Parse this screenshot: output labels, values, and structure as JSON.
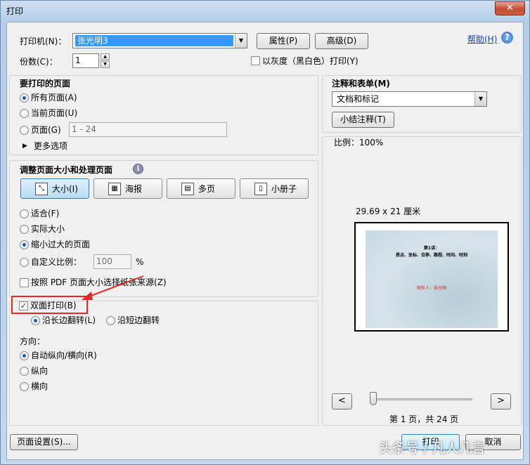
{
  "window": {
    "title": "打印",
    "close_glyph": "✕"
  },
  "header": {
    "printer_label": "打印机(N)：",
    "printer_value": "张光明3",
    "properties_button": "属性(P)",
    "advanced_button": "高级(D)",
    "help_link": "帮助(H)",
    "copies_label": "份数(C)：",
    "copies_value": "1",
    "grayscale_label": "以灰度（黑白色）打印(Y)"
  },
  "pages": {
    "title": "要打印的页面",
    "all_label": "所有页面(A)",
    "current_label": "当前页面(U)",
    "range_label": "页面(G)",
    "range_value": "1 - 24",
    "more_options": "更多选项"
  },
  "sizing": {
    "title": "调整页面大小和处理页面",
    "info_glyph": "i",
    "tabs": [
      {
        "label": "大小(I)",
        "glyph": "⤡"
      },
      {
        "label": "海报",
        "glyph": "▦"
      },
      {
        "label": "多页",
        "glyph": "▤"
      },
      {
        "label": "小册子",
        "glyph": "▯"
      }
    ],
    "fit_label": "适合(F)",
    "actual_label": "实际大小",
    "shrink_label": "缩小过大的页面",
    "custom_label": "自定义比例：",
    "custom_value": "100",
    "custom_unit": "%",
    "paper_source_label": "按照 PDF 页面大小选择纸张来源(Z)"
  },
  "duplex": {
    "label": "双面打印(B)",
    "long_edge_label": "沿长边翻转(L)",
    "short_edge_label": "沿短边翻转"
  },
  "orientation": {
    "title": "方向：",
    "auto_label": "自动纵向/横向(R)",
    "portrait_label": "纵向",
    "landscape_label": "横向"
  },
  "comments": {
    "title": "注释和表单(M)",
    "value": "文档和标记",
    "summarize_button": "小结注释(T)"
  },
  "preview": {
    "scale_text": "比例：100%",
    "size_text": "29.69 x 21 厘米",
    "slide_title": "第1讲：",
    "slide_subtitle": "质点、坐标、位移、路程、时间、时刻",
    "slide_author": "制作人：张光明",
    "prev_glyph": "<",
    "next_glyph": ">",
    "page_indicator": "第 1 页，共 24 页"
  },
  "footer": {
    "page_setup_button": "页面设置(S)...",
    "print_button": "打印",
    "cancel_button": "取消"
  },
  "watermark_text": "头条号 / 凡人几言",
  "colors": {
    "highlight": "#e32a2a",
    "accent": "#3399ff"
  }
}
